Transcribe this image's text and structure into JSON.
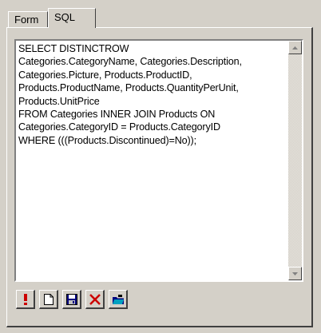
{
  "tabs": [
    {
      "label": "Form"
    },
    {
      "label": "SQL"
    }
  ],
  "sql": {
    "text": "SELECT DISTINCTROW\nCategories.CategoryName, Categories.Description,\nCategories.Picture, Products.ProductID,\nProducts.ProductName, Products.QuantityPerUnit,\nProducts.UnitPrice\nFROM Categories INNER JOIN Products ON\nCategories.CategoryID = Products.CategoryID\nWHERE (((Products.Discontinued)=No));"
  },
  "toolbar": {
    "buttons": [
      {
        "icon": "run-exclamation-icon"
      },
      {
        "icon": "new-document-icon"
      },
      {
        "icon": "save-disk-icon"
      },
      {
        "icon": "delete-x-icon"
      },
      {
        "icon": "open-folder-icon"
      }
    ]
  },
  "colors": {
    "face": "#d4d0c8",
    "run_red": "#cc0000",
    "save_blue": "#000080"
  }
}
